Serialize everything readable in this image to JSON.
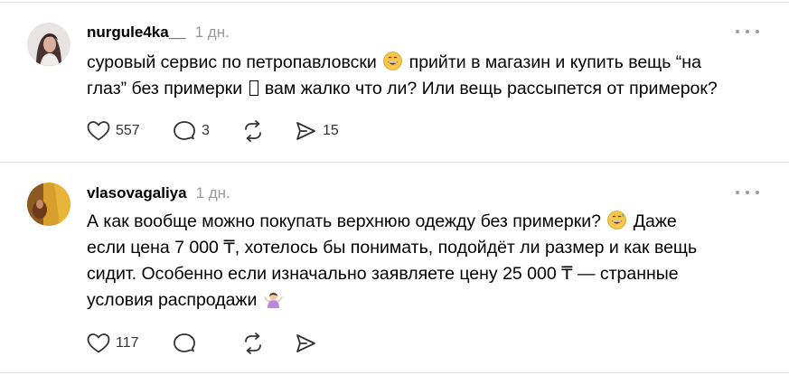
{
  "posts": [
    {
      "username": "nurgule4ka__",
      "timestamp": "1 дн.",
      "lines": [
        {
          "a": "суровый сервис по петропавловски ",
          "b": " прийти в магазин и купить вещь “на"
        },
        {
          "a": "глаз” без примерки ",
          "b": " вам жалко что ли? Или вещь рассыпется от примерок?"
        }
      ],
      "actions": {
        "likes": "557",
        "comments": "3",
        "reposts": "",
        "shares": "15"
      },
      "emojis": [
        "grinning-sweat-face-emoji",
        "missing-glyph"
      ]
    },
    {
      "username": "vlasovagaliya",
      "timestamp": "1 дн.",
      "lines": [
        {
          "a": "А как вообще можно покупать верхнюю одежду без примерки? ",
          "b": " Даже"
        },
        {
          "a": "если цена 7 000 ₸, хотелось бы понимать, подойдёт ли размер и как вещь",
          "b": ""
        },
        {
          "a": "сидит. Особенно если изначально заявляете цену 25 000 ₸ — странные",
          "b": ""
        },
        {
          "a": "условия распродажи ",
          "b": ""
        }
      ],
      "actions": {
        "likes": "117",
        "comments": "",
        "reposts": "",
        "shares": ""
      },
      "emojis": [
        "grinning-sweat-face-emoji",
        "woman-shrugging-emoji"
      ]
    }
  ],
  "colors": {
    "text": "#000000",
    "muted": "#999999",
    "icon": "#333333",
    "divider": "#e3e3e3"
  }
}
